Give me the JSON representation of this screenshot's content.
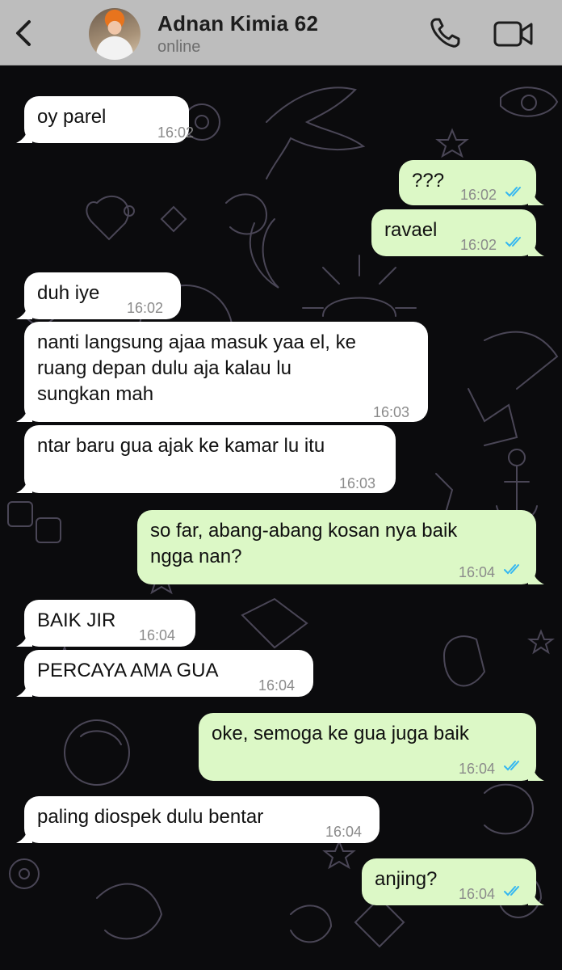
{
  "header": {
    "contact_name": "Adnan Kimia 62",
    "status": "online",
    "back_icon": "chevron-left-icon",
    "call_icon": "phone-icon",
    "video_icon": "video-camera-icon"
  },
  "colors": {
    "header_bg": "#bdbdbd",
    "wallpaper_bg": "#0b0b0d",
    "incoming_bubble": "#ffffff",
    "outgoing_bubble": "#dcf8c6",
    "read_ticks": "#34b7f1"
  },
  "messages": [
    {
      "direction": "in",
      "text": "oy parel",
      "time": "16:02"
    },
    {
      "direction": "out",
      "text": "???",
      "time": "16:02",
      "status": "read"
    },
    {
      "direction": "out",
      "text": "ravael",
      "time": "16:02",
      "status": "read"
    },
    {
      "direction": "in",
      "text": "duh iye",
      "time": "16:02"
    },
    {
      "direction": "in",
      "text": "nanti langsung ajaa masuk yaa el, ke\nruang depan dulu aja kalau lu\nsungkan mah",
      "time": "16:03"
    },
    {
      "direction": "in",
      "text": "ntar baru gua ajak ke kamar lu itu",
      "time": "16:03"
    },
    {
      "direction": "out",
      "text": "so far, abang-abang kosan nya baik\nngga nan?",
      "time": "16:04",
      "status": "read"
    },
    {
      "direction": "in",
      "text": "BAIK JIR",
      "time": "16:04"
    },
    {
      "direction": "in",
      "text": "PERCAYA AMA GUA",
      "time": "16:04"
    },
    {
      "direction": "out",
      "text": "oke, semoga ke gua juga baik",
      "time": "16:04",
      "status": "read"
    },
    {
      "direction": "in",
      "text": "paling diospek dulu bentar",
      "time": "16:04"
    },
    {
      "direction": "out",
      "text": "anjing?",
      "time": "16:04",
      "status": "read"
    }
  ]
}
